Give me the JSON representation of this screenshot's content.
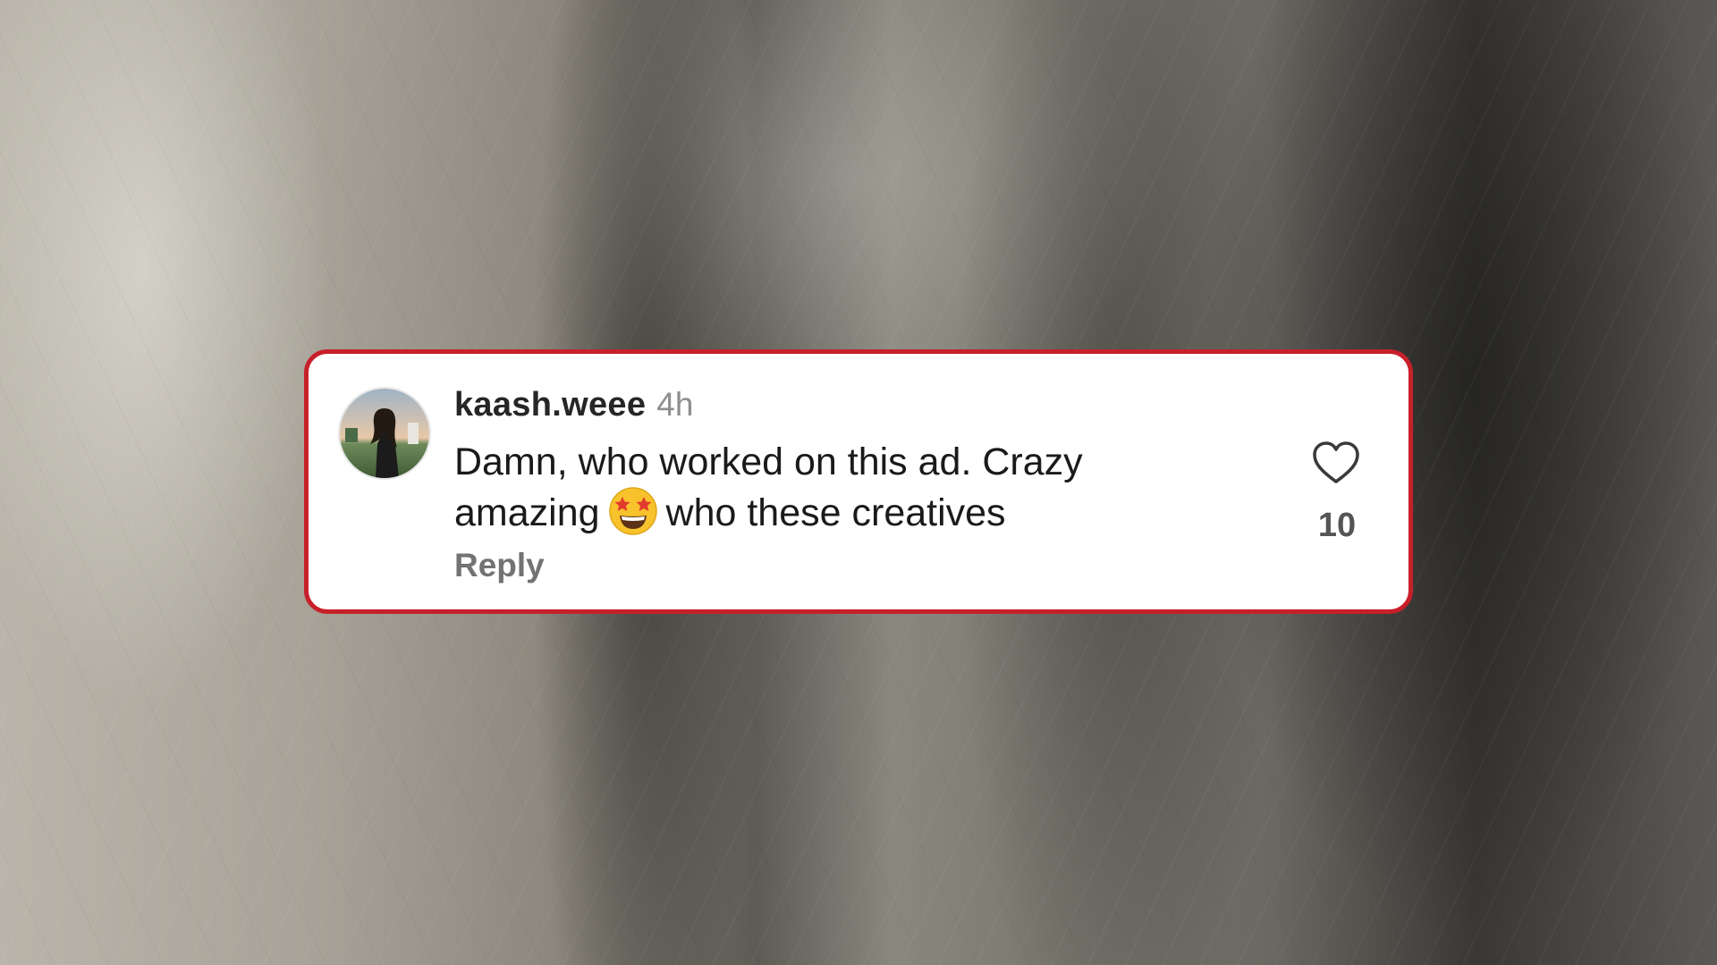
{
  "comment": {
    "username": "kaash.weee",
    "time": "4h",
    "text_line1": "Damn, who worked on this ad. Crazy",
    "text_line2_before": "amazing",
    "text_line2_after": "who these creatives",
    "emoji": "star-struck-emoji",
    "reply_label": "Reply",
    "like_count": "10"
  },
  "colors": {
    "card_border": "#c8202a",
    "card_background": "#ffffff",
    "username": "#262626",
    "time": "#8e8e8e",
    "reply": "#737373"
  },
  "icons": {
    "like": "heart-outline-icon",
    "avatar": "avatar"
  }
}
